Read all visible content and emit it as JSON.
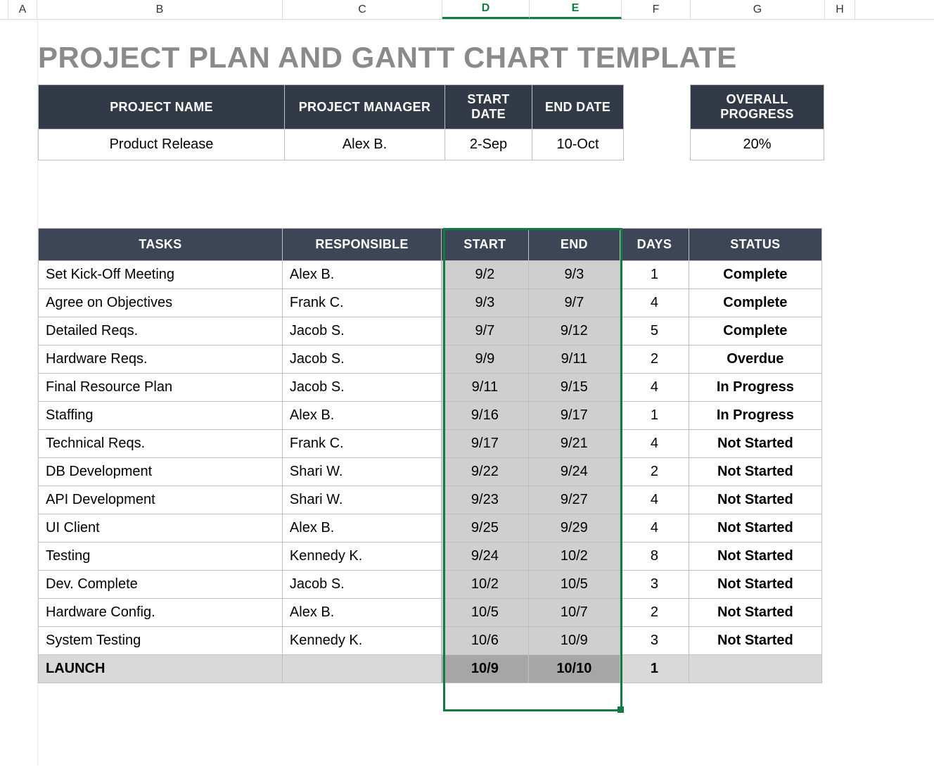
{
  "columns": [
    "A",
    "B",
    "C",
    "D",
    "E",
    "F",
    "G",
    "H"
  ],
  "selected_columns": [
    "D",
    "E"
  ],
  "title": "PROJECT PLAN AND GANTT CHART TEMPLATE",
  "info_headers": {
    "name": "PROJECT NAME",
    "manager": "PROJECT MANAGER",
    "start": "START DATE",
    "end": "END DATE",
    "progress": "OVERALL PROGRESS"
  },
  "info": {
    "name": "Product Release",
    "manager": "Alex B.",
    "start": "2-Sep",
    "end": "10-Oct",
    "progress": "20%"
  },
  "task_headers": {
    "tasks": "TASKS",
    "responsible": "RESPONSIBLE",
    "start": "START",
    "end": "END",
    "days": "DAYS",
    "status": "STATUS"
  },
  "tasks": [
    {
      "task": "Set Kick-Off Meeting",
      "responsible": "Alex B.",
      "start": "9/2",
      "end": "9/3",
      "days": "1",
      "status": "Complete",
      "status_class": "Complete"
    },
    {
      "task": "Agree on Objectives",
      "responsible": "Frank C.",
      "start": "9/3",
      "end": "9/7",
      "days": "4",
      "status": "Complete",
      "status_class": "Complete"
    },
    {
      "task": "Detailed Reqs.",
      "responsible": "Jacob S.",
      "start": "9/7",
      "end": "9/12",
      "days": "5",
      "status": "Complete",
      "status_class": "Complete"
    },
    {
      "task": "Hardware Reqs.",
      "responsible": "Jacob S.",
      "start": "9/9",
      "end": "9/11",
      "days": "2",
      "status": "Overdue",
      "status_class": "Overdue"
    },
    {
      "task": "Final Resource Plan",
      "responsible": "Jacob S.",
      "start": "9/11",
      "end": "9/15",
      "days": "4",
      "status": "In Progress",
      "status_class": "InProgress"
    },
    {
      "task": "Staffing",
      "responsible": "Alex B.",
      "start": "9/16",
      "end": "9/17",
      "days": "1",
      "status": "In Progress",
      "status_class": "InProgress"
    },
    {
      "task": "Technical Reqs.",
      "responsible": "Frank C.",
      "start": "9/17",
      "end": "9/21",
      "days": "4",
      "status": "Not Started",
      "status_class": "NotStarted"
    },
    {
      "task": "DB Development",
      "responsible": "Shari W.",
      "start": "9/22",
      "end": "9/24",
      "days": "2",
      "status": "Not Started",
      "status_class": "NotStarted"
    },
    {
      "task": "API Development",
      "responsible": "Shari W.",
      "start": "9/23",
      "end": "9/27",
      "days": "4",
      "status": "Not Started",
      "status_class": "NotStarted"
    },
    {
      "task": "UI Client",
      "responsible": "Alex B.",
      "start": "9/25",
      "end": "9/29",
      "days": "4",
      "status": "Not Started",
      "status_class": "NotStarted"
    },
    {
      "task": "Testing",
      "responsible": "Kennedy K.",
      "start": "9/24",
      "end": "10/2",
      "days": "8",
      "status": "Not Started",
      "status_class": "NotStarted"
    },
    {
      "task": "Dev. Complete",
      "responsible": "Jacob S.",
      "start": "10/2",
      "end": "10/5",
      "days": "3",
      "status": "Not Started",
      "status_class": "NotStarted"
    },
    {
      "task": "Hardware Config.",
      "responsible": "Alex B.",
      "start": "10/5",
      "end": "10/7",
      "days": "2",
      "status": "Not Started",
      "status_class": "NotStarted"
    },
    {
      "task": "System Testing",
      "responsible": "Kennedy K.",
      "start": "10/6",
      "end": "10/9",
      "days": "3",
      "status": "Not Started",
      "status_class": "NotStarted"
    },
    {
      "task": "LAUNCH",
      "responsible": "",
      "start": "10/9",
      "end": "10/10",
      "days": "1",
      "status": "",
      "status_class": "",
      "launch": true
    }
  ],
  "chart_data": {
    "type": "table",
    "title": "Project Plan Gantt Data",
    "columns": [
      "Task",
      "Responsible",
      "Start",
      "End",
      "Days",
      "Status"
    ],
    "rows": [
      [
        "Set Kick-Off Meeting",
        "Alex B.",
        "9/2",
        "9/3",
        1,
        "Complete"
      ],
      [
        "Agree on Objectives",
        "Frank C.",
        "9/3",
        "9/7",
        4,
        "Complete"
      ],
      [
        "Detailed Reqs.",
        "Jacob S.",
        "9/7",
        "9/12",
        5,
        "Complete"
      ],
      [
        "Hardware Reqs.",
        "Jacob S.",
        "9/9",
        "9/11",
        2,
        "Overdue"
      ],
      [
        "Final Resource Plan",
        "Jacob S.",
        "9/11",
        "9/15",
        4,
        "In Progress"
      ],
      [
        "Staffing",
        "Alex B.",
        "9/16",
        "9/17",
        1,
        "In Progress"
      ],
      [
        "Technical Reqs.",
        "Frank C.",
        "9/17",
        "9/21",
        4,
        "Not Started"
      ],
      [
        "DB Development",
        "Shari W.",
        "9/22",
        "9/24",
        2,
        "Not Started"
      ],
      [
        "API Development",
        "Shari W.",
        "9/23",
        "9/27",
        4,
        "Not Started"
      ],
      [
        "UI Client",
        "Alex B.",
        "9/25",
        "9/29",
        4,
        "Not Started"
      ],
      [
        "Testing",
        "Kennedy K.",
        "9/24",
        "10/2",
        8,
        "Not Started"
      ],
      [
        "Dev. Complete",
        "Jacob S.",
        "10/2",
        "10/5",
        3,
        "Not Started"
      ],
      [
        "Hardware Config.",
        "Alex B.",
        "10/5",
        "10/7",
        2,
        "Not Started"
      ],
      [
        "System Testing",
        "Kennedy K.",
        "10/6",
        "10/9",
        3,
        "Not Started"
      ],
      [
        "LAUNCH",
        "",
        "10/9",
        "10/10",
        1,
        ""
      ]
    ]
  }
}
